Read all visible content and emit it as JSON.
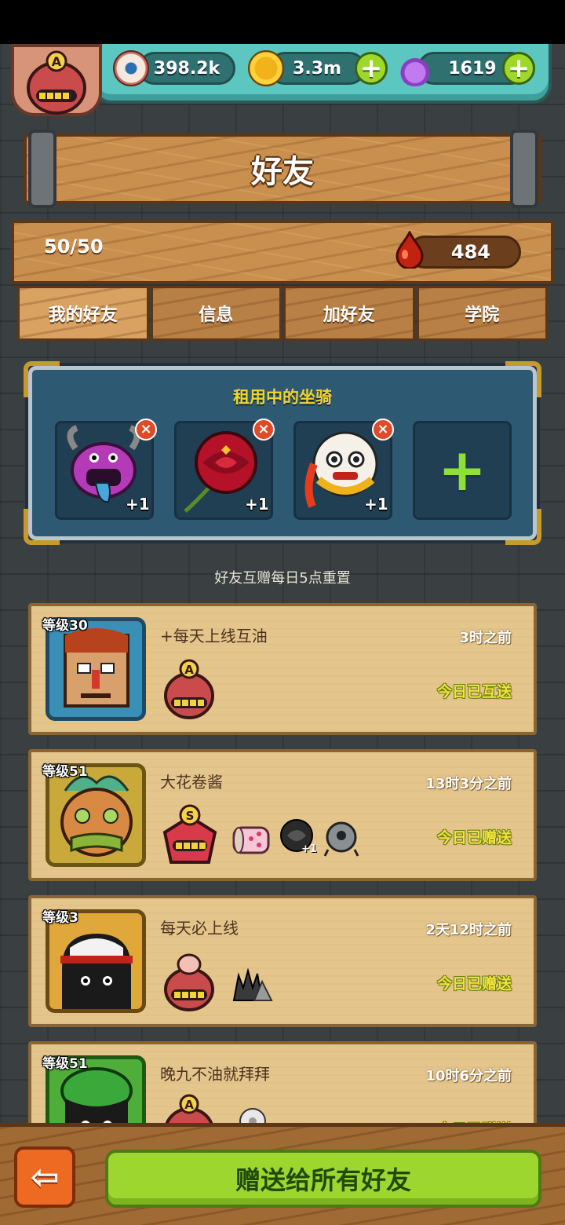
{
  "currencies": {
    "eyeballs": "398.2k",
    "coins": "3.3m",
    "potions": "1619"
  },
  "title": "好友",
  "friend_count": "50/50",
  "blood_drops": "484",
  "tabs": [
    "我的好友",
    "信息",
    "加好友",
    "学院"
  ],
  "active_tab": "我的好友",
  "mounts": {
    "title": "租用中的坐骑",
    "slots": [
      {
        "icon": "purple-horned-monster-icon",
        "bonus": "+1"
      },
      {
        "icon": "red-rose-icon",
        "bonus": "+1"
      },
      {
        "icon": "lion-dance-head-icon",
        "bonus": "+1"
      }
    ],
    "add_label": "+"
  },
  "reset_note": "好友互赠每日5点重置",
  "friends": [
    {
      "level": "等级30",
      "name": "+每天上线互油",
      "time": "3时之前",
      "status": "今日已互送",
      "portrait": "blockhead-portrait-icon",
      "items": [
        "rank-a-badge-icon"
      ]
    },
    {
      "level": "等级51",
      "name": "大花卷酱",
      "time": "13时3分之前",
      "status": "今日已赠送",
      "portrait": "feathered-bear-portrait-icon",
      "items": [
        "rank-s-badge-icon",
        "pink-drum-icon",
        "black-rose-icon",
        "grey-robot-icon"
      ],
      "item_bonus": "+1"
    },
    {
      "level": "等级3",
      "name": "每天必上线",
      "time": "2天12时之前",
      "status": "今日已赠送",
      "portrait": "black-blob-portrait-icon",
      "items": [
        "brain-badge-icon",
        "spiky-machine-icon"
      ]
    },
    {
      "level": "等级51",
      "name": "晚九不油就拜拜",
      "time": "10时6分之前",
      "status": "今日已赠送",
      "portrait": "green-cap-portrait-icon",
      "items": [
        "rank-a-badge-icon",
        "white-flower-icon"
      ]
    }
  ],
  "back_label": "⇦",
  "send_all_label": "赠送给所有好友"
}
